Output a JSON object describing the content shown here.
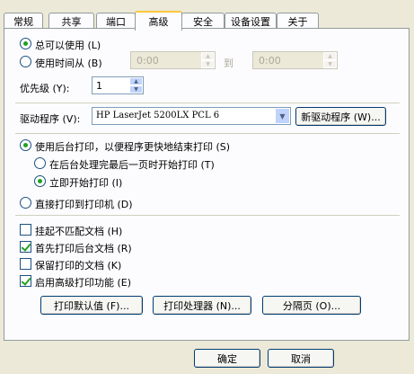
{
  "tabs": [
    {
      "label": "常规",
      "active": false
    },
    {
      "label": "共享",
      "active": false
    },
    {
      "label": "端口",
      "active": false
    },
    {
      "label": "高级",
      "active": true
    },
    {
      "label": "安全",
      "active": false
    },
    {
      "label": "设备设置",
      "active": false
    },
    {
      "label": "关于",
      "active": false
    }
  ],
  "availability": {
    "always_label": "总可以使用 (L)",
    "time_label": "使用时间从 (B)",
    "time_from": "0:00",
    "to_label": "到",
    "time_to": "0:00",
    "selected": "always"
  },
  "priority": {
    "label": "优先级 (Y):",
    "value": "1"
  },
  "driver": {
    "label": "驱动程序 (V):",
    "value": "HP LaserJet 5200LX PCL 6",
    "new_button": "新驱动程序 (W)..."
  },
  "spool": {
    "spool_label": "使用后台打印，以便程序更快地结束打印 (S)",
    "after_last_page_label": "在后台处理完最后一页时开始打印 (T)",
    "immediately_label": "立即开始打印 (I)",
    "direct_label": "直接打印到打印机 (D)",
    "mode": "spool",
    "start": "immediately"
  },
  "options": [
    {
      "label": "挂起不匹配文档 (H)",
      "checked": false
    },
    {
      "label": "首先打印后台文档 (R)",
      "checked": true
    },
    {
      "label": "保留打印的文档 (K)",
      "checked": false
    },
    {
      "label": "启用高级打印功能 (E)",
      "checked": true
    }
  ],
  "buttons": {
    "defaults": "打印默认值 (F)...",
    "processor": "打印处理器 (N)...",
    "separator_page": "分隔页 (O)...",
    "ok": "确定",
    "cancel": "取消"
  }
}
